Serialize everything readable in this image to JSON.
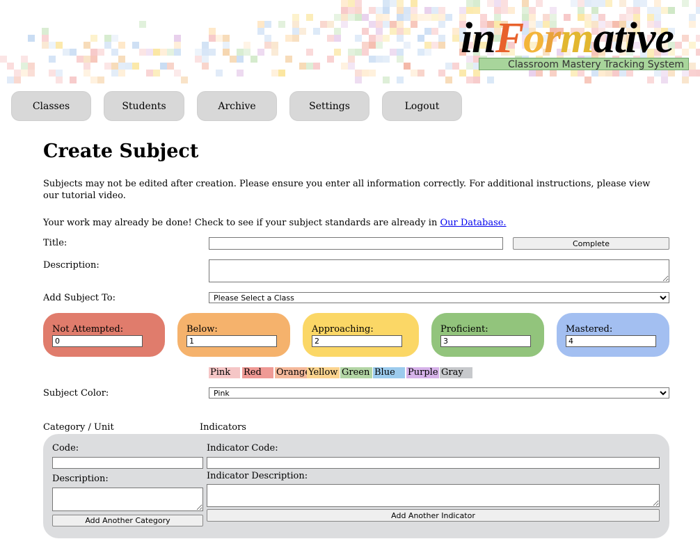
{
  "header": {
    "logo": {
      "p1": "in",
      "p2": "F",
      "p3": "o",
      "p4": "r",
      "p5": "m",
      "p6": "ative"
    },
    "tagline": "Classroom Mastery Tracking System"
  },
  "nav": [
    "Classes",
    "Students",
    "Archive",
    "Settings",
    "Logout"
  ],
  "page": {
    "title": "Create Subject",
    "intro": "Subjects may not be edited after creation. Please ensure you enter all information correctly. For additional instructions, please view our tutorial video.",
    "db_text": "Your work may already be done! Check to see if your subject standards are already in ",
    "db_link": "Our Database."
  },
  "form": {
    "title_label": "Title:",
    "title_value": "",
    "complete_button": "Complete",
    "description_label": "Description:",
    "description_value": "",
    "add_to_label": "Add Subject To:",
    "add_to_selected": "Please Select a Class",
    "levels": [
      {
        "label": "Not Attempted:",
        "value": "0",
        "color": "#e07c6c"
      },
      {
        "label": "Below:",
        "value": "1",
        "color": "#f5b26c"
      },
      {
        "label": "Approaching:",
        "value": "2",
        "color": "#fbd766"
      },
      {
        "label": "Proficient:",
        "value": "3",
        "color": "#92c47c"
      },
      {
        "label": "Mastered:",
        "value": "4",
        "color": "#a3bff1"
      }
    ],
    "color_swatches": [
      {
        "name": "Pink",
        "color": "#f5c6c6"
      },
      {
        "name": "Red",
        "color": "#ef9a95"
      },
      {
        "name": "Orange",
        "color": "#f5b99b"
      },
      {
        "name": "Yellow",
        "color": "#fbd48f"
      },
      {
        "name": "Green",
        "color": "#b3d5a5"
      },
      {
        "name": "Blue",
        "color": "#9ccbed"
      },
      {
        "name": "Purple",
        "color": "#d6b3e9"
      },
      {
        "name": "Gray",
        "color": "#c7c9cc"
      }
    ],
    "subject_color_label": "Subject Color:",
    "subject_color_selected": "Pink"
  },
  "categories": {
    "col1_header": "Category / Unit",
    "col2_header": "Indicators",
    "code_label": "Code:",
    "code_value": "",
    "description_label": "Description:",
    "description_value": "",
    "add_category_button": "Add Another Category",
    "indicator_code_label": "Indicator Code:",
    "indicator_code_value": "",
    "indicator_description_label": "Indicator Description:",
    "indicator_description_value": "",
    "add_indicator_button": "Add Another Indicator"
  }
}
